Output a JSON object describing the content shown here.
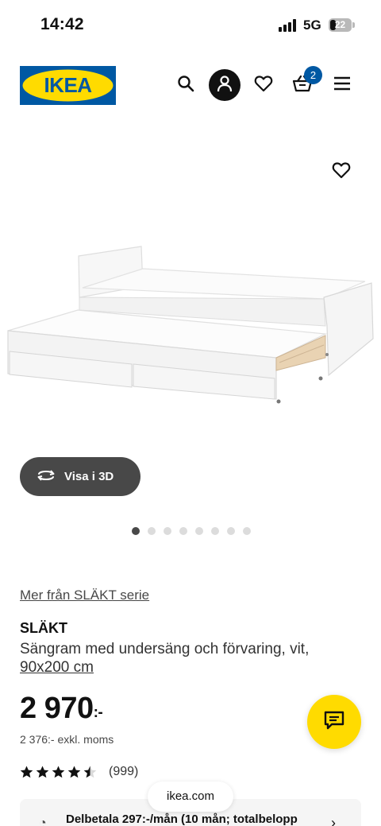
{
  "status_bar": {
    "time": "14:42",
    "network": "5G",
    "battery": "22"
  },
  "header": {
    "logo_text": "IKEA",
    "cart_count": "2",
    "colors": {
      "logo_blue": "#0058a3",
      "logo_yellow": "#ffdb00"
    }
  },
  "hero": {
    "view3d_label": "Visa i 3D",
    "dots_total": 8,
    "dots_active_index": 0
  },
  "product": {
    "series_link": "Mer från SLÄKT serie",
    "name": "SLÄKT",
    "description": "Sängram med undersäng och förvaring, vit,",
    "size": "90x200 cm",
    "price_main": "2 970",
    "price_suffix": ":-",
    "price_excl": "2 376:- exkl. moms",
    "rating_value": 4.5,
    "rating_max": 5,
    "rating_count": "(999)"
  },
  "finance": {
    "text": "Delbetala 297:-/mån (10 mån; totalbelopp"
  },
  "browser": {
    "url": "ikea.com"
  },
  "icons": [
    "search-icon",
    "account-icon",
    "heart-icon",
    "cart-icon",
    "menu-icon",
    "rotate-3d-icon",
    "chat-icon",
    "star-icon",
    "chevron-right-icon"
  ],
  "colors": {
    "chat_yellow": "#ffdb00",
    "badge_blue": "#0058a3",
    "button_dark": "#484848"
  }
}
